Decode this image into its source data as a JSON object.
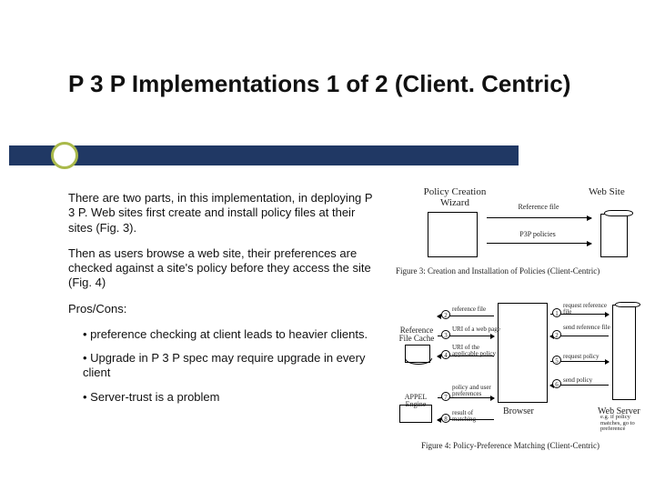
{
  "title": "P 3 P Implementations 1 of 2 (Client. Centric)",
  "paragraphs": {
    "p1": "There are two parts, in this implementation, in deploying P 3 P.  Web sites first create and install policy files at their sites (Fig. 3).",
    "p2": "Then as users browse a web site, their preferences are checked against a site's policy before they access the site (Fig. 4)",
    "p3": "Pros/Cons:"
  },
  "bullets": {
    "b1": "• preference checking at client leads to heavier clients.",
    "b2": "• Upgrade in P 3 P spec may require upgrade in every client",
    "b3": "• Server-trust is a problem"
  },
  "fig3": {
    "wizard": "Policy Creation Wizard",
    "website": "Web Site",
    "ref": "Reference file",
    "p3p": "P3P policies",
    "caption": "Figure 3:  Creation and Installation of Policies (Client-Centric)"
  },
  "fig4": {
    "refcache": "Reference File Cache",
    "browser": "Browser",
    "server": "Web Server",
    "appel": "APPEL Engine",
    "left": {
      "l1": "reference file",
      "l2": "URI of a web page",
      "l3": "URI of the applicable policy",
      "l4": "policy and user preferences",
      "l5": "result of matching"
    },
    "right": {
      "r1": "request reference file",
      "r2": "send reference file",
      "r3": "request policy",
      "r4": "send policy"
    },
    "prefnote": "e.g. if policy matches, go to preference",
    "caption": "Figure 4: Policy-Preference Matching (Client-Centric)",
    "nums": {
      "n2": "2",
      "n3": "3",
      "n4": "4",
      "n7": "7",
      "n8": "8",
      "r1": "1",
      "r2": "2",
      "r5": "5",
      "r6": "6"
    }
  }
}
